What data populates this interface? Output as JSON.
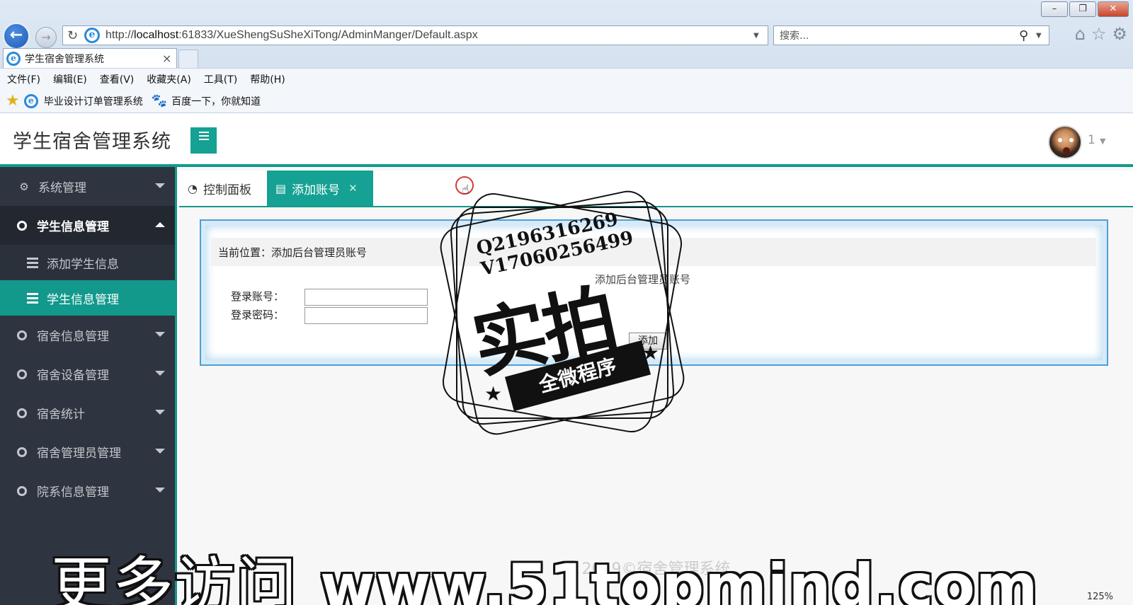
{
  "browser": {
    "window_controls": [
      "–",
      "❐",
      "✕"
    ],
    "back_icon": "back-arrow-icon",
    "url_host": "localhost",
    "url_prefix": "http://",
    "url_rest": ":61833/XueShengSuSheXiTong/AdminManger/Default.aspx",
    "search_placeholder": "搜索...",
    "tab_title": "学生宿舍管理系统",
    "tab_close": "×",
    "menu": [
      "文件(F)",
      "编辑(E)",
      "查看(V)",
      "收藏夹(A)",
      "工具(T)",
      "帮助(H)"
    ],
    "favorites": [
      "毕业设计订单管理系统",
      "百度一下，你就知道"
    ],
    "zoom": "125%"
  },
  "app": {
    "title": "学生宿舍管理系统",
    "user_name": "1",
    "accent_color": "#12998c"
  },
  "sidebar": {
    "items": [
      {
        "label": "系统管理"
      },
      {
        "label": "学生信息管理"
      },
      {
        "label": "添加学生信息"
      },
      {
        "label": "学生信息管理"
      },
      {
        "label": "宿舍信息管理"
      },
      {
        "label": "宿舍设备管理"
      },
      {
        "label": "宿舍统计"
      },
      {
        "label": "宿舍管理员管理"
      },
      {
        "label": "院系信息管理"
      }
    ]
  },
  "tabs": {
    "dashboard": "控制面板",
    "add_account": "添加账号"
  },
  "panel": {
    "location": "当前位置：添加后台管理员账号",
    "form_title": "添加后台管理员账号",
    "login_label": "登录账号：",
    "password_label": "登录密码：",
    "login_value": "",
    "password_value": "",
    "submit": "添加"
  },
  "footer": "2019©宿舍管理系统",
  "overlay": {
    "stamp_q": "Q2196316269",
    "stamp_v": "V17060256499",
    "stamp_big": "实拍",
    "stamp_ribbon": "全微程序",
    "watermark_cn": "更多访问",
    "watermark_url": "www.51topmind.com"
  }
}
